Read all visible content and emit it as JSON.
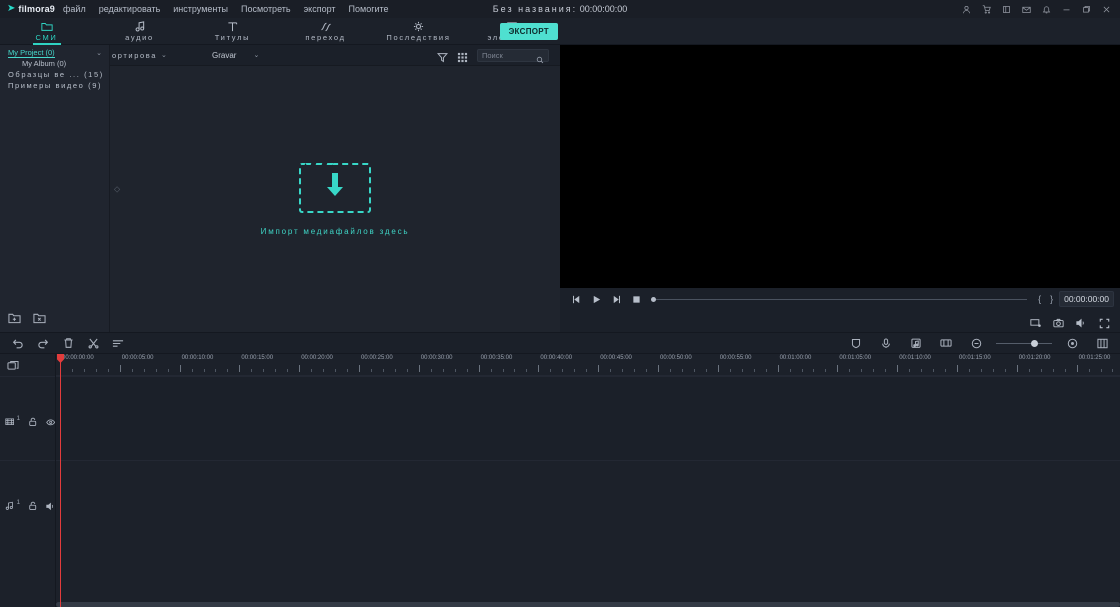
{
  "app": {
    "brand": "filmora9",
    "brand_mark": "▶",
    "accent": "#2fd3c2",
    "doc_title_prefix": "Без названия:",
    "doc_timecode": "00:00:00:00"
  },
  "menu": {
    "items": [
      {
        "label": "файл",
        "name": "menu-file"
      },
      {
        "label": "редактировать",
        "name": "menu-edit"
      },
      {
        "label": "инструменты",
        "name": "menu-tools"
      },
      {
        "label": "Посмотреть",
        "name": "menu-view"
      },
      {
        "label": "экспорт",
        "name": "menu-export"
      },
      {
        "label": "Помогите",
        "name": "menu-help"
      }
    ]
  },
  "window_controls": [
    {
      "name": "account-icon",
      "glyph": "user"
    },
    {
      "name": "cart-icon",
      "glyph": "cart"
    },
    {
      "name": "store-icon",
      "glyph": "store"
    },
    {
      "name": "mail-icon",
      "glyph": "mail"
    },
    {
      "name": "notification-icon",
      "glyph": "bell"
    },
    {
      "name": "minimize-button",
      "glyph": "minimize"
    },
    {
      "name": "maximize-button",
      "glyph": "maximize"
    },
    {
      "name": "close-button",
      "glyph": "close"
    }
  ],
  "tabs": [
    {
      "label": "СМИ",
      "icon": "folder-icon",
      "active": true
    },
    {
      "label": "аудио",
      "icon": "music-note-icon",
      "active": false
    },
    {
      "label": "Титулы",
      "icon": "text-title-icon",
      "active": false
    },
    {
      "label": "переход",
      "icon": "transition-icon",
      "active": false
    },
    {
      "label": "Последствия",
      "icon": "effects-icon",
      "active": false
    },
    {
      "label": "элементы",
      "icon": "elements-icon",
      "active": false
    }
  ],
  "export_button": {
    "label": "ЭКСПОРТ"
  },
  "library": {
    "tree": [
      {
        "label": "My Project (0)",
        "selected": true,
        "indent": false,
        "spaced": false,
        "chevron": "⌄"
      },
      {
        "label": "My Album (0)",
        "selected": false,
        "indent": true,
        "spaced": false
      },
      {
        "label": "Образцы ве ... (15)",
        "selected": false,
        "indent": false,
        "spaced": true
      },
      {
        "label": "Примеры видео (9)",
        "selected": false,
        "indent": false,
        "spaced": true
      }
    ],
    "footer_buttons": [
      {
        "name": "new-folder-button",
        "icon": "folder-plus-icon"
      },
      {
        "name": "delete-folder-button",
        "icon": "folder-remove-icon"
      }
    ]
  },
  "media_toolbar": {
    "sort_label": "ортирова",
    "record_label": "Gravar",
    "filter_icon": "filter-icon",
    "grid_icon": "grid-view-icon",
    "search_placeholder": "Поиск",
    "search_value": ""
  },
  "drop_zone": {
    "hint": "Импорт медиафайлов здесь",
    "icon": "download-arrow-icon"
  },
  "player": {
    "controls": [
      {
        "name": "previous-frame-button",
        "icon": "step-backward-icon"
      },
      {
        "name": "play-button",
        "icon": "play-icon"
      },
      {
        "name": "next-frame-button",
        "icon": "step-forward-icon"
      },
      {
        "name": "stop-button",
        "icon": "stop-icon"
      }
    ],
    "mark_in": "{",
    "mark_out": "}",
    "timecode": "00:00:00:00",
    "scrub_position_pct": 0,
    "bottom_controls": [
      {
        "name": "snapshot-to-timeline-button",
        "icon": "screen-record-icon"
      },
      {
        "name": "snapshot-button",
        "icon": "camera-icon"
      },
      {
        "name": "volume-button",
        "icon": "speaker-icon"
      },
      {
        "name": "fullscreen-button",
        "icon": "fullscreen-icon"
      }
    ]
  },
  "timeline_toolbar": {
    "left": [
      {
        "name": "undo-button",
        "icon": "undo-icon"
      },
      {
        "name": "redo-button",
        "icon": "redo-icon"
      },
      {
        "name": "delete-button",
        "icon": "trash-icon"
      },
      {
        "name": "split-button",
        "icon": "scissors-icon"
      },
      {
        "name": "crop-button",
        "icon": "crop-lines-icon"
      }
    ],
    "right": [
      {
        "name": "color-tune-button",
        "icon": "shield-icon"
      },
      {
        "name": "record-voiceover-button",
        "icon": "microphone-icon"
      },
      {
        "name": "audio-detach-button",
        "icon": "music-note-icon"
      },
      {
        "name": "crop-zoom-button",
        "icon": "crop-box-icon"
      },
      {
        "name": "zoom-out-button",
        "icon": "zoom-out-icon"
      },
      {
        "name": "zoom-in-button",
        "icon": "zoom-in-icon"
      },
      {
        "name": "fit-timeline-button",
        "icon": "fit-grid-icon"
      }
    ],
    "zoom_slider_pct": 68
  },
  "timeline": {
    "marker_icon": "marker-icon",
    "playhead_time": "00:00:00:00",
    "ruler_ticks": [
      "00:00:00:00",
      "00:00:05:00",
      "00:00:10:00",
      "00:00:15:00",
      "00:00:20:00",
      "00:00:25:00",
      "00:00:30:00",
      "00:00:35:00",
      "00:00:40:00",
      "00:00:45:00",
      "00:00:50:00",
      "00:00:55:00",
      "00:01:00:00",
      "00:01:05:00",
      "00:01:10:00",
      "00:01:15:00",
      "00:01:20:00",
      "00:01:25:00"
    ],
    "tracks": [
      {
        "type": "video",
        "number": "1",
        "icon": "video-track-icon",
        "lock_icon": "lock-open-icon",
        "visibility_icon": "eye-icon"
      },
      {
        "type": "audio",
        "number": "1",
        "icon": "audio-track-icon",
        "lock_icon": "lock-open-icon",
        "visibility_icon": "speaker-icon"
      }
    ]
  }
}
